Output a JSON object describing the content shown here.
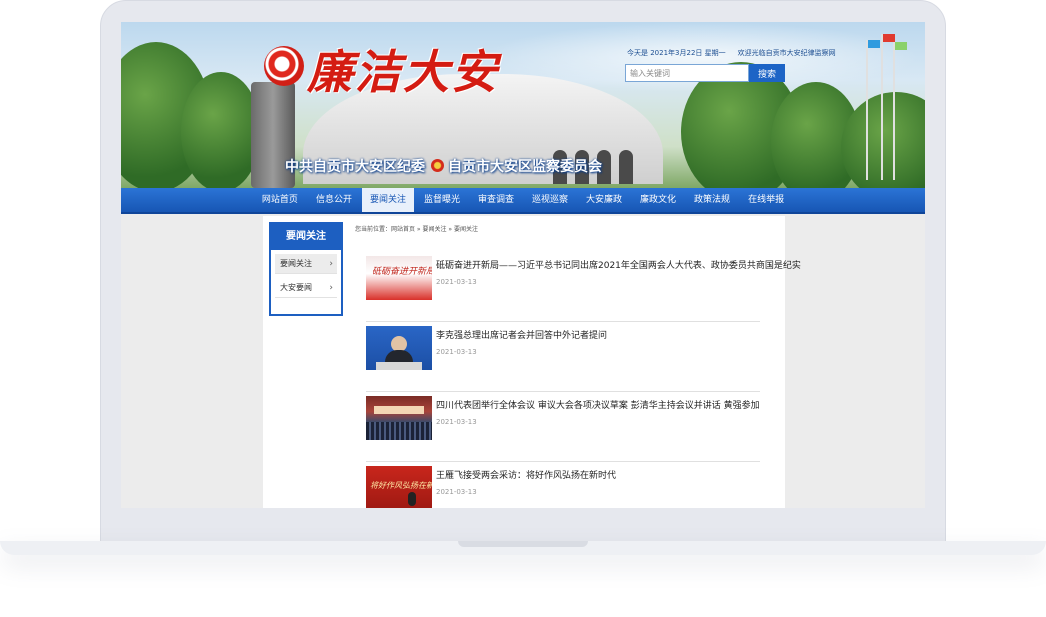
{
  "site": {
    "logo_text": "廉洁大安",
    "org_left": "中共自贡市大安区纪委",
    "org_right": "自贡市大安区监察委员会"
  },
  "topbar": {
    "date": "今天是 2021年3月22日 星期一",
    "welcome": "欢迎光临自贡市大安纪律监察网"
  },
  "search": {
    "placeholder": "输入关键词",
    "button": "搜索"
  },
  "nav": [
    {
      "label": "网站首页"
    },
    {
      "label": "信息公开"
    },
    {
      "label": "要闻关注",
      "active": true
    },
    {
      "label": "监督曝光"
    },
    {
      "label": "审查调查"
    },
    {
      "label": "巡视巡察"
    },
    {
      "label": "大安廉政"
    },
    {
      "label": "廉政文化"
    },
    {
      "label": "政策法规"
    },
    {
      "label": "在线举报"
    }
  ],
  "sidebar": {
    "title": "要闻关注",
    "items": [
      {
        "label": "要闻关注",
        "active": true
      },
      {
        "label": "大安要闻"
      }
    ]
  },
  "breadcrumb": "您当前位置：网站首页 » 要闻关注 » 要闻关注",
  "news": [
    {
      "title": "砥砺奋进开新局——习近平总书记同出席2021年全国两会人大代表、政协委员共商国是纪实",
      "date": "2021-03-13",
      "thumb_text": "砥砺奋进开新局"
    },
    {
      "title": "李克强总理出席记者会并回答中外记者提问",
      "date": "2021-03-13"
    },
    {
      "title": "四川代表团举行全体会议 审议大会各项决议草案 彭清华主持会议并讲话 黄强参加",
      "date": "2021-03-13"
    },
    {
      "title": "王雁飞接受两会采访：将好作风弘扬在新时代",
      "date": "2021-03-13",
      "thumb_text": "将好作风弘扬在新时代"
    }
  ]
}
